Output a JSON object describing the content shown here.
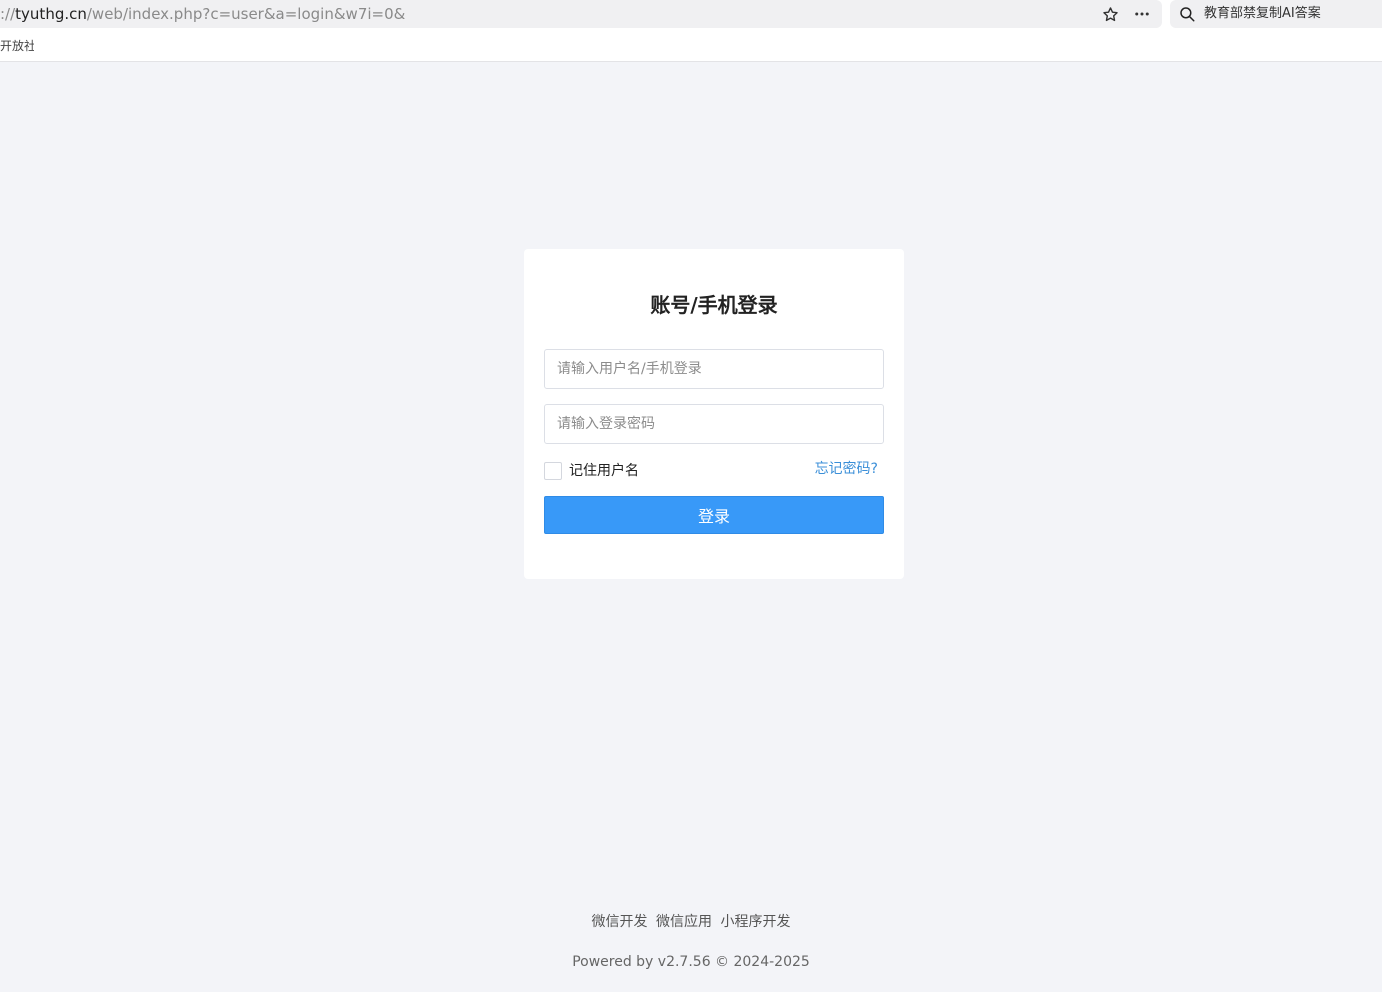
{
  "browser": {
    "url_prefix": "://",
    "url_host": "tyuthg.cn",
    "url_path": "/web/index.php?c=user&a=login&w7i=0&",
    "star_icon": "star-icon",
    "more_icon": "more-icon",
    "search_icon": "search-icon",
    "search_text": "教育部禁复制AI答案",
    "bookmark_label": "开放社"
  },
  "login": {
    "title": "账号/手机登录",
    "username_placeholder": "请输入用户名/手机登录",
    "password_placeholder": "请输入登录密码",
    "remember_label": "记住用户名",
    "forgot_label": "忘记密码?",
    "submit_label": "登录"
  },
  "footer": {
    "links": [
      "微信开发",
      "微信应用",
      "小程序开发"
    ],
    "copyright": "Powered by v2.7.56 © 2024-2025"
  },
  "colors": {
    "page_bg": "#f3f4f8",
    "primary": "#3899f8",
    "link": "#3b8fd8"
  }
}
